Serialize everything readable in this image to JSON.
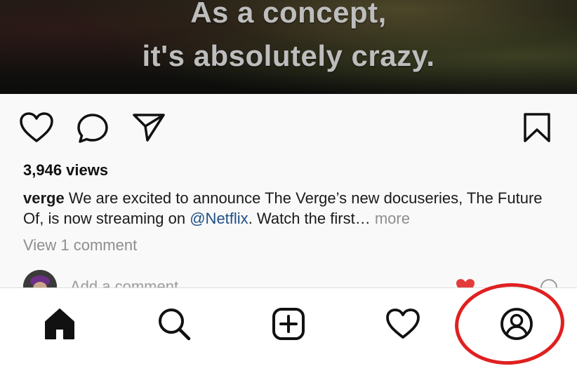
{
  "video": {
    "subtitle_line1": "As a concept,",
    "subtitle_line2": "it's absolutely crazy."
  },
  "actions": {
    "like_icon": "heart-outline-icon",
    "comment_icon": "speech-bubble-icon",
    "share_icon": "paper-plane-icon",
    "save_icon": "bookmark-icon"
  },
  "post": {
    "views": "3,946 views",
    "username": "verge",
    "caption_part1": " We are excited to announce The Verge’s new docuseries, The Future Of, is now streaming on ",
    "mention": "@Netflix",
    "caption_part2": ". Watch the first…",
    "more_label": " more",
    "view_comments": "View 1 comment"
  },
  "comment_box": {
    "placeholder": "Add a comment…"
  },
  "bottom_nav": {
    "items": [
      {
        "id": "home",
        "icon": "home-icon",
        "active": true
      },
      {
        "id": "search",
        "icon": "search-icon"
      },
      {
        "id": "create",
        "icon": "plus-square-icon"
      },
      {
        "id": "activity",
        "icon": "heart-icon"
      },
      {
        "id": "profile",
        "icon": "profile-icon"
      }
    ]
  },
  "colors": {
    "mention": "#1e4f86",
    "muted_text": "#8e8e8e",
    "highlight": "#e02020"
  }
}
